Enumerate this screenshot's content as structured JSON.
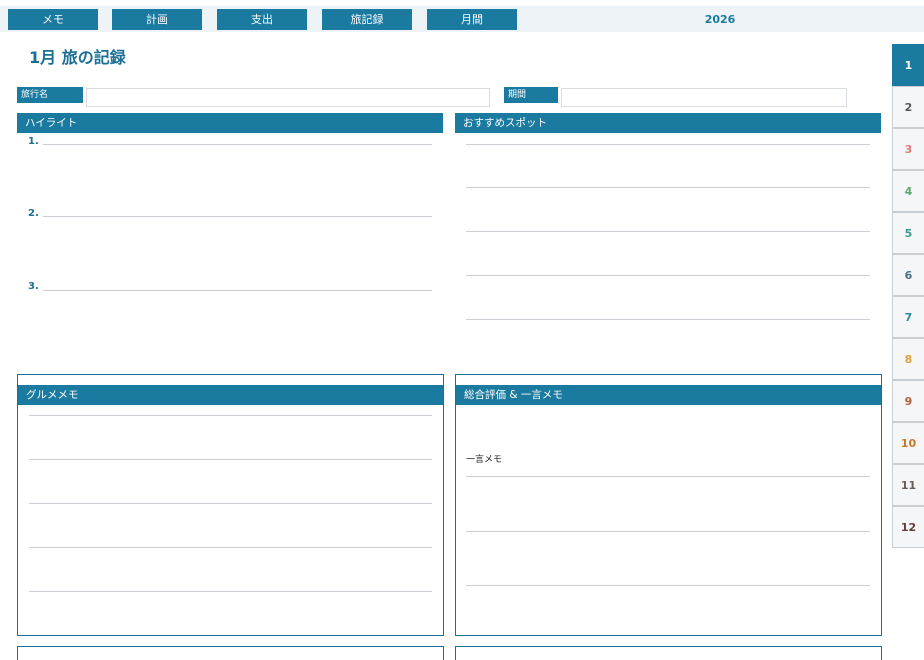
{
  "nav": {
    "tabs": [
      {
        "label": "メモ"
      },
      {
        "label": "計画"
      },
      {
        "label": "支出"
      },
      {
        "label": "旅記録"
      },
      {
        "label": "月間"
      }
    ],
    "year": "2026"
  },
  "page": {
    "title": "1月 旅の記録"
  },
  "fields": {
    "trip_name_label": "旅行名",
    "trip_name_value": "",
    "period_label": "期間",
    "period_value": ""
  },
  "sections": {
    "highlights": {
      "title": "ハイライト",
      "numbers": [
        "1.",
        "2.",
        "3."
      ]
    },
    "spots": {
      "title": "おすすめスポット"
    },
    "gourmet": {
      "title": "グルメメモ"
    },
    "rating": {
      "title": "総合評価 & 一言メモ",
      "memo_label": "一言メモ"
    }
  },
  "months": [
    {
      "label": "1",
      "color": "#ffffff"
    },
    {
      "label": "2",
      "color": "#555555"
    },
    {
      "label": "3",
      "color": "#e07a7a"
    },
    {
      "label": "4",
      "color": "#5aa86a"
    },
    {
      "label": "5",
      "color": "#3f9a8a"
    },
    {
      "label": "6",
      "color": "#4d6f84"
    },
    {
      "label": "7",
      "color": "#2f8aa0"
    },
    {
      "label": "8",
      "color": "#e0a13a"
    },
    {
      "label": "9",
      "color": "#b5603a"
    },
    {
      "label": "10",
      "color": "#c9782a"
    },
    {
      "label": "11",
      "color": "#6b5d55"
    },
    {
      "label": "12",
      "color": "#6b3a3a"
    }
  ]
}
